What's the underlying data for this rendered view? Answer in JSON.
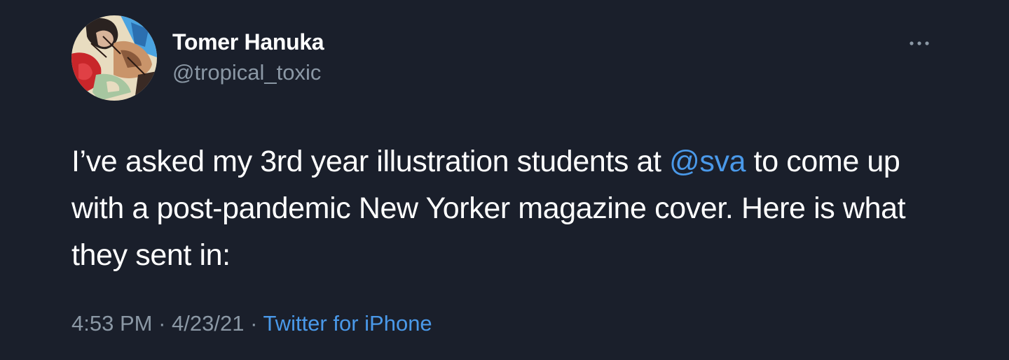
{
  "user": {
    "display_name": "Tomer Hanuka",
    "handle": "@tropical_toxic"
  },
  "tweet": {
    "text_part1": "I’ve asked my 3rd year illustration students at ",
    "mention": "@sva",
    "text_part2": " to come up with a post-pandemic New Yorker magazine cover. Here is what they sent in:"
  },
  "meta": {
    "time": "4:53 PM",
    "separator1": " · ",
    "date": "4/23/21",
    "separator2": " · ",
    "source": "Twitter for iPhone"
  },
  "icons": {
    "more": "more-icon",
    "avatar": "avatar-illustration"
  },
  "colors": {
    "background": "#1a1f2b",
    "text": "#ffffff",
    "secondary": "#8b98a5",
    "link": "#4a99e9"
  }
}
